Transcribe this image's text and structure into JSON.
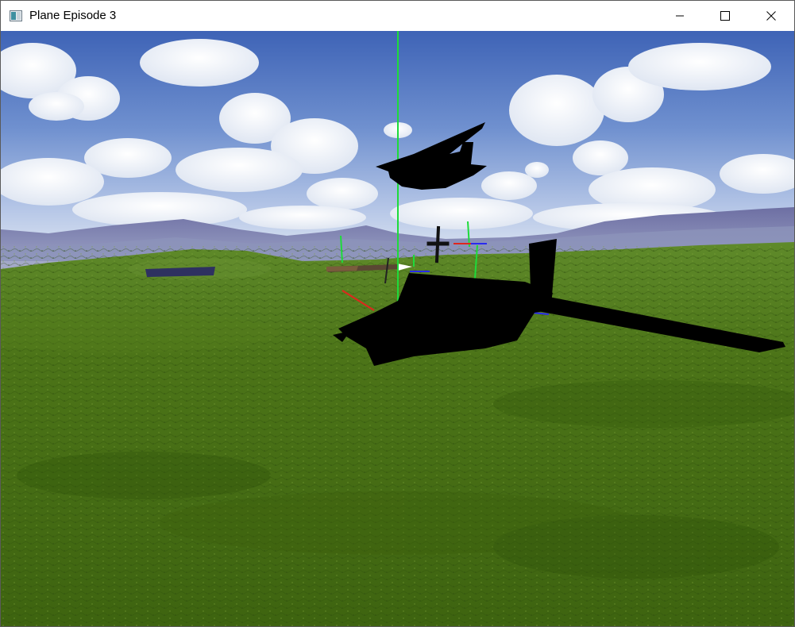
{
  "window": {
    "title": "Plane Episode 3",
    "controls": {
      "minimize": "minimize-icon",
      "maximize": "maximize-icon",
      "close": "close-icon"
    }
  },
  "scene": {
    "sky_top": "#3d63b5",
    "sky_horizon": "#c9d6ec",
    "mountains": "#7479a8",
    "grass": "#496f16",
    "axis_colors": {
      "x": "#e0261d",
      "y": "#1edb3a",
      "z": "#2a2af0"
    }
  }
}
